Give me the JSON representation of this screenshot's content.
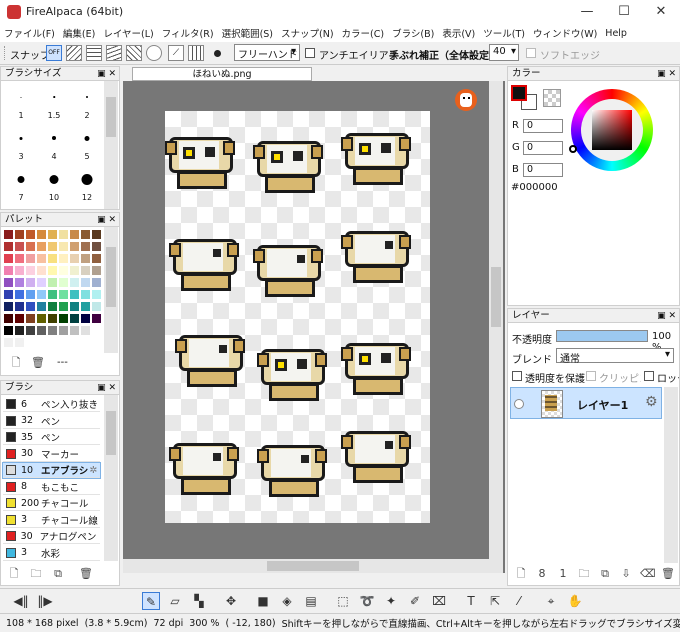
{
  "window": {
    "title": "FireAlpaca (64bit)",
    "minimize": "—",
    "maximize": "☐",
    "close": "✕"
  },
  "menu": [
    "ファイル(F)",
    "編集(E)",
    "レイヤー(L)",
    "フィルタ(R)",
    "選択範囲(S)",
    "スナップ(N)",
    "カラー(C)",
    "ブラシ(B)",
    "表示(V)",
    "ツール(T)",
    "ウィンドウ(W)",
    "Help"
  ],
  "toolbar": {
    "snap_label": "スナップ",
    "snap_off_label": "OFF",
    "mode_value": "フリーハンド",
    "antialias_label": "アンチエイリアス",
    "stabilizer_label": "手ぶれ補正（全体設定）",
    "stabilizer_value": "40",
    "soft_edge_label": "ソフトエッジ"
  },
  "brush_size_panel": {
    "title": "ブラシサイズ",
    "sizes": [
      "1",
      "1.5",
      "2",
      "3",
      "4",
      "5",
      "7",
      "10",
      "12"
    ]
  },
  "palette_panel": {
    "title": "パレット",
    "label": "---"
  },
  "brush_panel": {
    "title": "ブラシ",
    "items": [
      {
        "size": "6",
        "name": "ペン入り抜き",
        "color": "#222222"
      },
      {
        "size": "32",
        "name": "ペン",
        "color": "#222222"
      },
      {
        "size": "35",
        "name": "ペン",
        "color": "#222222"
      },
      {
        "size": "30",
        "name": "マーカー",
        "color": "#e02020"
      },
      {
        "size": "10",
        "name": "エアブラシ",
        "color": "#dddddd"
      },
      {
        "size": "8",
        "name": "もこもこ",
        "color": "#e02020"
      },
      {
        "size": "200",
        "name": "チャコール",
        "color": "#f0e030"
      },
      {
        "size": "3",
        "name": "チャコール線",
        "color": "#f0e030"
      },
      {
        "size": "30",
        "name": "アナログペン (",
        "color": "#e02020"
      },
      {
        "size": "3",
        "name": "水彩",
        "color": "#40b8e0"
      }
    ]
  },
  "document": {
    "tab_label": "ほねいぬ.png"
  },
  "color_panel": {
    "title": "カラー",
    "r_label": "R",
    "r_value": "0",
    "g_label": "G",
    "g_value": "0",
    "b_label": "B",
    "b_value": "0",
    "hex": "#000000"
  },
  "layer_panel": {
    "title": "レイヤー",
    "opacity_label": "不透明度",
    "opacity_value": "100 %",
    "opacity_fraction": 1.0,
    "blend_label": "ブレンド",
    "blend_value": "通常",
    "protect_label": "透明度を保護",
    "clipping_label": "クリッピング",
    "lock_label": "ロック",
    "layer_name": "レイヤー1"
  },
  "status": {
    "size": "108 * 168 pixel",
    "cm": "(3.8 * 5.9cm)",
    "dpi": "72 dpi",
    "zoom": "300 %",
    "coords": "( -12, 180)",
    "hint": "Shiftキーを押しながらで直線描画、Ctrl+Altキーを押しながら左右ドラッグでブラシサイズ変更"
  },
  "colors": {
    "accent": "#3a7bd5",
    "selection": "#cce4ff",
    "canvas_bg": "#777777"
  }
}
